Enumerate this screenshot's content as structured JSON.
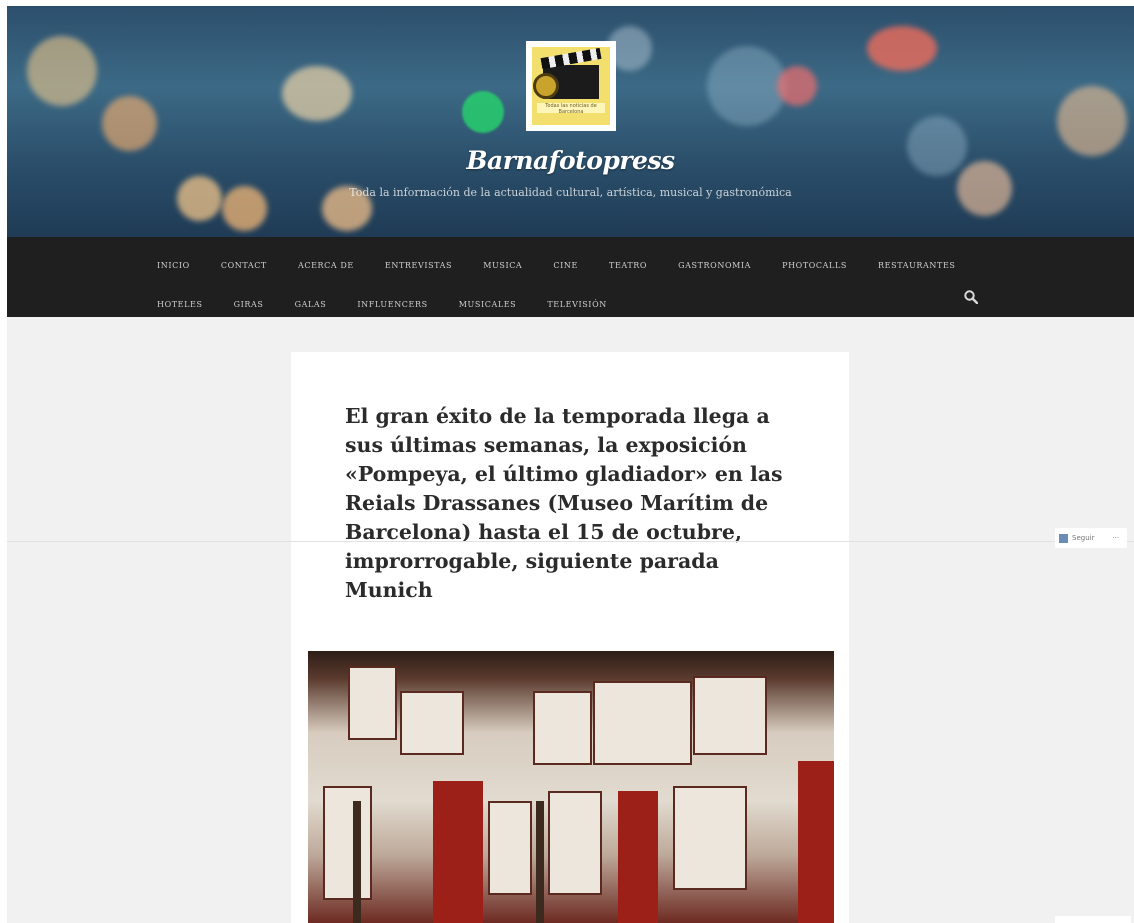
{
  "site": {
    "title": "Barnafotopress",
    "tagline": "Toda la información de la actualidad cultural, artística, musical y gastronómica",
    "logo_caption": "Todas las noticias de Barcelona"
  },
  "nav": {
    "row1": [
      "INICIO",
      "CONTACT",
      "ACERCA DE",
      "ENTREVISTAS",
      "MUSICA",
      "CINE",
      "TEATRO",
      "GASTRONOMIA",
      "PHOTOCALLS",
      "RESTAURANTES"
    ],
    "row2": [
      "HOTELES",
      "GIRAS",
      "GALAS",
      "INFLUENCERS",
      "MUSICALES",
      "TELEVISIÓN"
    ],
    "search_icon": "search-icon"
  },
  "post": {
    "title": "El gran éxito de la temporada llega a sus últimas semanas, la exposición «Pompeya, el último gladiador» en las Reials Drassanes (Museo Marítim de Barcelona) hasta el 15 de octubre, improrrogable, siguiente parada Munich"
  },
  "follow": {
    "label": "Seguir",
    "more": "···"
  },
  "colors": {
    "nav_bg": "#1f1f1f",
    "page_bg": "#f1f1f1",
    "title_text": "#2b2b2b"
  }
}
